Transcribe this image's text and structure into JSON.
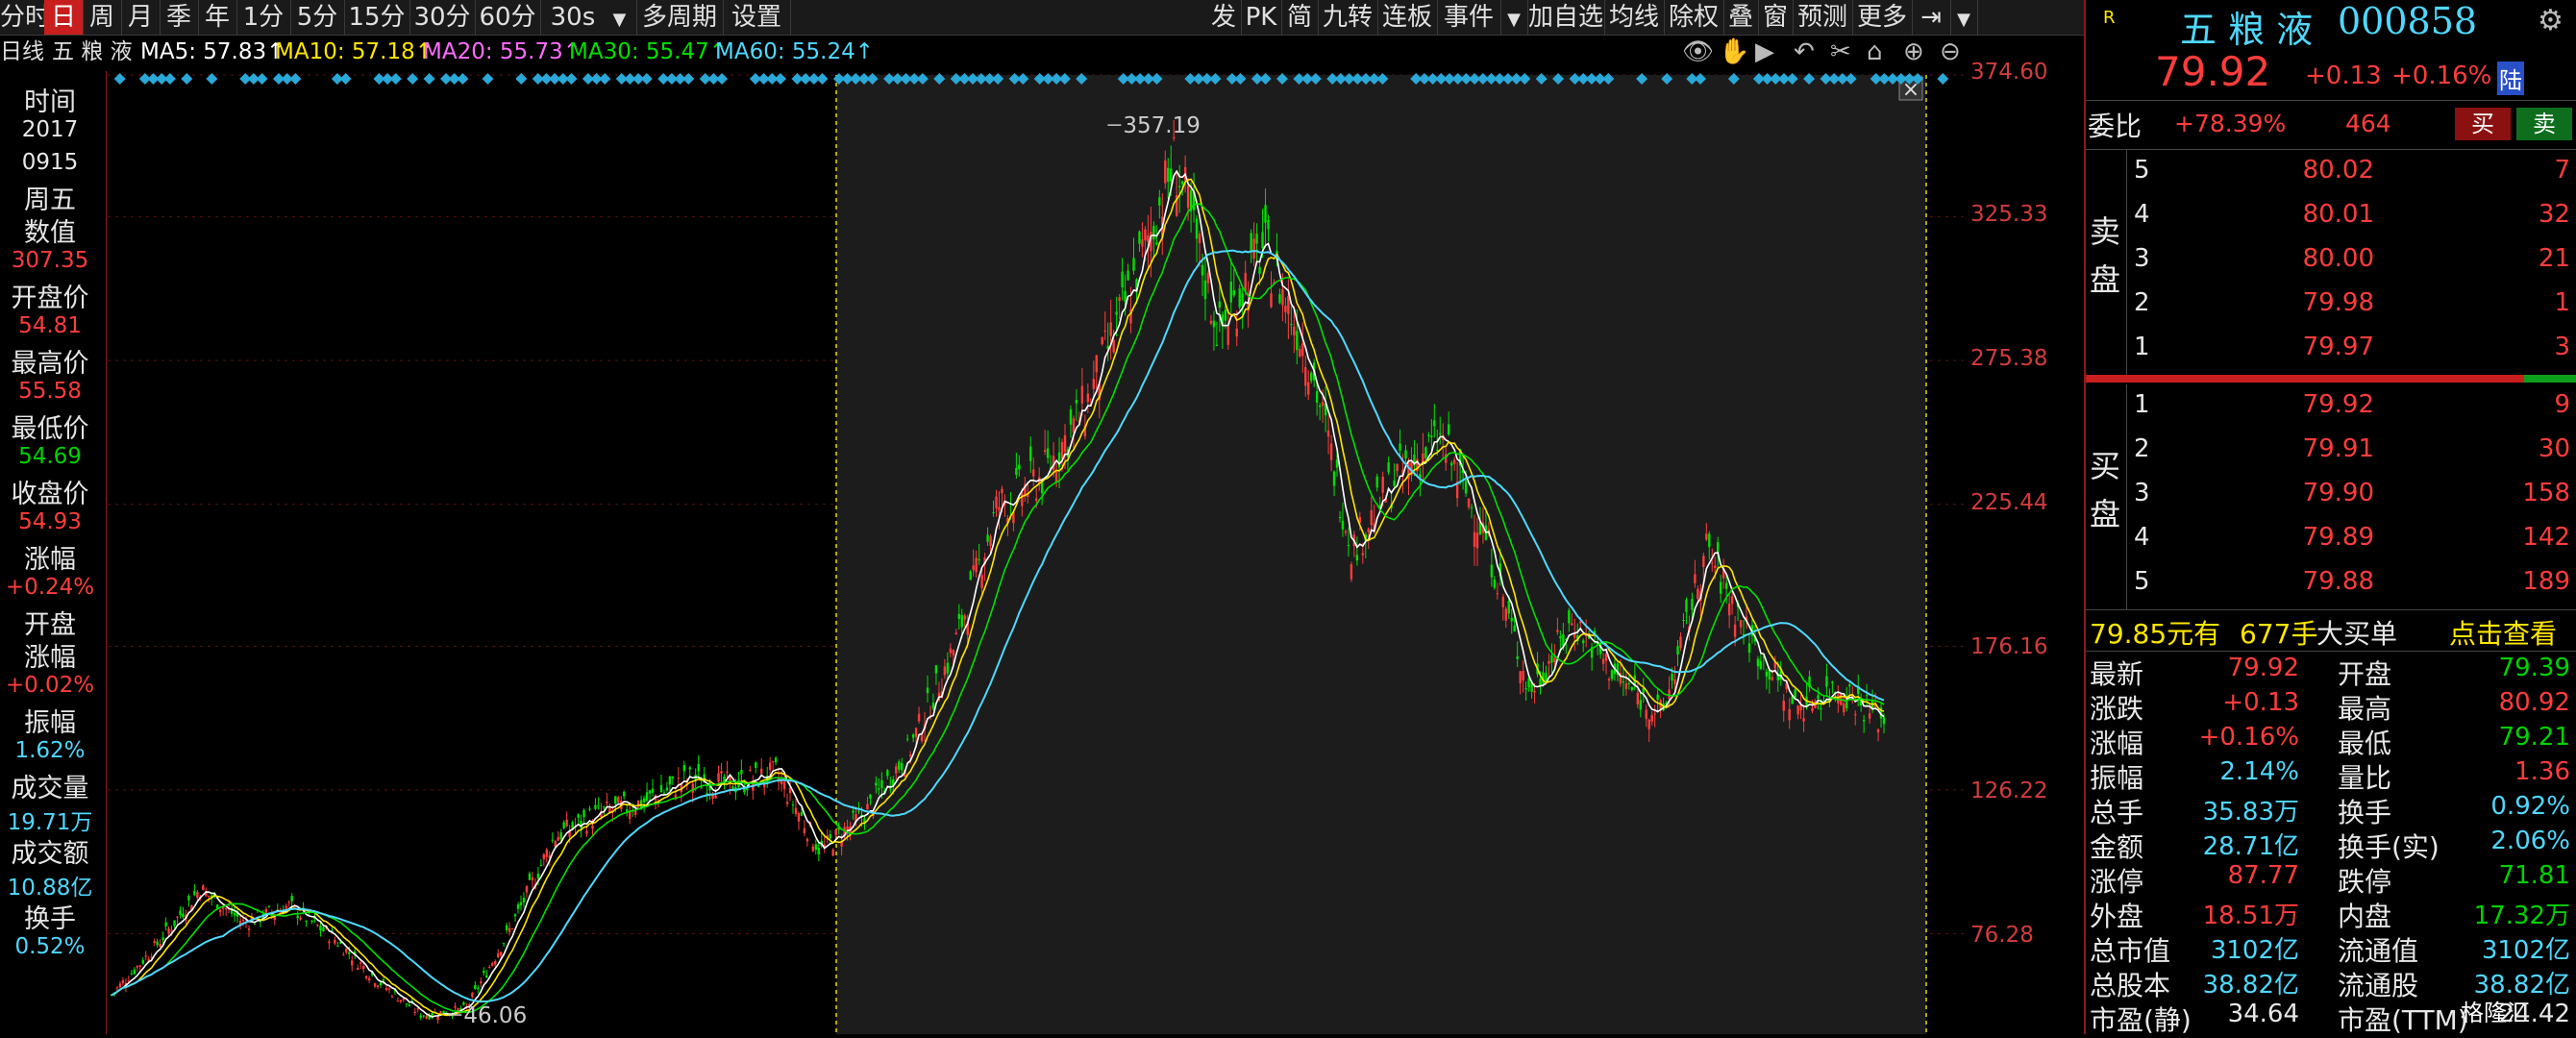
{
  "toolbar": {
    "left_items": [
      "分时",
      "日",
      "周",
      "月",
      "季",
      "年",
      "1分",
      "5分",
      "15分",
      "30分",
      "60分",
      "30s",
      "多周期",
      "设置"
    ],
    "active_index": 1,
    "right_items": [
      "发",
      "PK",
      "简",
      "九转",
      "连板",
      "事件",
      "加自选",
      "均线",
      "除权",
      "叠",
      "窗",
      "预测",
      "更多"
    ]
  },
  "ma_line": {
    "period": "日线",
    "stock": "五 粮 液",
    "ma5": "MA5: 57.83↑",
    "ma10": "MA10: 57.18↑",
    "ma20": "MA20: 55.73↑",
    "ma30": "MA30: 55.47↑",
    "ma60": "MA60: 55.24↑"
  },
  "left_panel": {
    "time_label": "时间",
    "year": "2017",
    "date": "0915",
    "weekday": "周五",
    "value_label": "数值",
    "value": "307.35",
    "open_label": "开盘价",
    "open": "54.81",
    "high_label": "最高价",
    "high": "55.58",
    "low_label": "最低价",
    "low": "54.69",
    "close_label": "收盘价",
    "close": "54.93",
    "chg_label": "涨幅",
    "chg": "+0.24%",
    "open_chg_label1": "开盘",
    "open_chg_label2": "涨幅",
    "open_chg": "+0.02%",
    "amp_label": "振幅",
    "amp": "1.62%",
    "vol_label": "成交量",
    "vol": "19.71万",
    "amt_label": "成交额",
    "amt": "10.88亿",
    "turn_label": "换手",
    "turn": "0.52%"
  },
  "price_axis": [
    "374.60",
    "325.33",
    "275.38",
    "225.44",
    "176.16",
    "126.22",
    "76.28"
  ],
  "annotations": {
    "high": "357.19",
    "low": "46.06"
  },
  "chart_data": {
    "type": "line",
    "note_series": "close",
    "x": [
      0,
      5,
      10,
      15,
      20,
      25,
      30,
      35,
      40,
      45,
      50,
      55,
      60,
      65,
      70,
      75,
      80,
      85,
      90,
      95,
      100,
      105,
      110,
      115,
      120,
      125,
      130,
      135,
      140,
      145,
      150,
      155,
      160,
      165,
      170,
      175,
      180,
      185,
      190,
      195,
      200
    ],
    "values": [
      55,
      72,
      92,
      80,
      86,
      75,
      60,
      48,
      50,
      78,
      110,
      118,
      122,
      130,
      128,
      132,
      105,
      118,
      140,
      175,
      225,
      235,
      260,
      300,
      345,
      285,
      315,
      278,
      210,
      235,
      248,
      215,
      160,
      185,
      165,
      152,
      210,
      178,
      155,
      162,
      150
    ],
    "ylim": [
      46.06,
      374.6
    ],
    "high": 357.19,
    "low": 46.06
  },
  "quote": {
    "badge": "R",
    "name": "五 粮 液",
    "code": "000858",
    "price": "79.92",
    "change": "+0.13",
    "pct": "+0.16%",
    "market": "陆",
    "weibi_label": "委比",
    "weibi": "+78.39%",
    "weicha": "464",
    "buy_btn": "买",
    "sell_btn": "卖",
    "sell_label": "卖盘",
    "buy_label": "买盘",
    "asks": [
      {
        "lvl": "5",
        "price": "80.02",
        "vol": "7"
      },
      {
        "lvl": "4",
        "price": "80.01",
        "vol": "32"
      },
      {
        "lvl": "3",
        "price": "80.00",
        "vol": "21"
      },
      {
        "lvl": "2",
        "price": "79.98",
        "vol": "1"
      },
      {
        "lvl": "1",
        "price": "79.97",
        "vol": "3"
      }
    ],
    "bids": [
      {
        "lvl": "1",
        "price": "79.92",
        "vol": "9"
      },
      {
        "lvl": "2",
        "price": "79.91",
        "vol": "30"
      },
      {
        "lvl": "3",
        "price": "79.90",
        "vol": "158"
      },
      {
        "lvl": "4",
        "price": "79.89",
        "vol": "142"
      },
      {
        "lvl": "5",
        "price": "79.88",
        "vol": "189"
      }
    ],
    "big_order": {
      "price": "79.85元有",
      "qty": "677手",
      "type": "大买单",
      "link": "点击查看"
    },
    "stats": [
      {
        "l1": "最新",
        "v1": "79.92",
        "c1": "red",
        "l2": "开盘",
        "v2": "79.39",
        "c2": "green"
      },
      {
        "l1": "涨跌",
        "v1": "+0.13",
        "c1": "red",
        "l2": "最高",
        "v2": "80.92",
        "c2": "red"
      },
      {
        "l1": "涨幅",
        "v1": "+0.16%",
        "c1": "red",
        "l2": "最低",
        "v2": "79.21",
        "c2": "green"
      },
      {
        "l1": "振幅",
        "v1": "2.14%",
        "c1": "cyan",
        "l2": "量比",
        "v2": "1.36",
        "c2": "red"
      },
      {
        "l1": "总手",
        "v1": "35.83万",
        "c1": "cyan",
        "l2": "换手",
        "v2": "0.92%",
        "c2": "cyan"
      },
      {
        "l1": "金额",
        "v1": "28.71亿",
        "c1": "cyan",
        "l2": "换手(实)",
        "v2": "2.06%",
        "c2": "cyan"
      },
      {
        "l1": "涨停",
        "v1": "87.77",
        "c1": "red",
        "l2": "跌停",
        "v2": "71.81",
        "c2": "green"
      },
      {
        "l1": "外盘",
        "v1": "18.51万",
        "c1": "red",
        "l2": "内盘",
        "v2": "17.32万",
        "c2": "green"
      },
      {
        "l1": "总市值",
        "v1": "3102亿",
        "c1": "cyan",
        "l2": "流通值",
        "v2": "3102亿",
        "c2": "cyan"
      },
      {
        "l1": "总股本",
        "v1": "38.82亿",
        "c1": "cyan",
        "l2": "流通股",
        "v2": "38.82亿",
        "c2": "cyan"
      },
      {
        "l1": "市盈(静)",
        "v1": "34.64",
        "c1": "white",
        "l2": "市盈(TTM)",
        "v2": "24.42",
        "c2": "white"
      }
    ],
    "watermark": "格隆汇"
  },
  "colors": {
    "up": "#ff3c3c",
    "down": "#00d200",
    "accent": "#4fd8ff",
    "ma5": "#ffffff",
    "ma10": "#ffe600",
    "ma20": "#ff6cff",
    "ma30": "#00e000",
    "ma60": "#4fd8ff"
  }
}
